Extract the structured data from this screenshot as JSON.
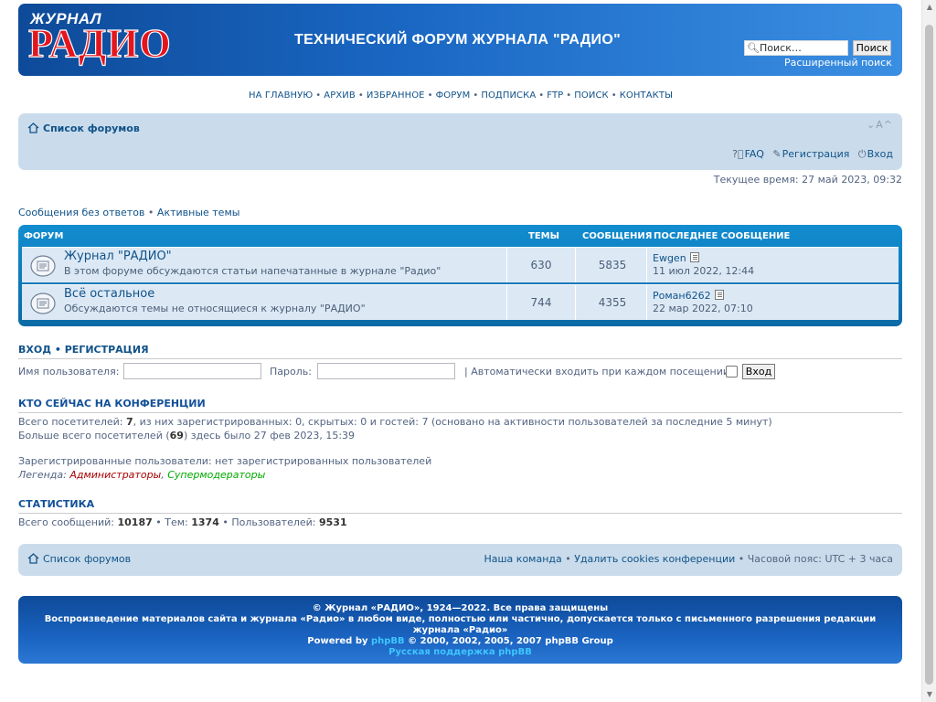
{
  "header": {
    "logo_top": "ЖУРНАЛ",
    "logo_main": "РАДИО",
    "site_title": "ТЕХНИЧЕСКИЙ ФОРУМ ЖУРНАЛА \"РАДИО\"",
    "search_placeholder": "Поиск…",
    "search_button": "Поиск",
    "advanced_search": "Расширенный поиск"
  },
  "nav_links": [
    "НА ГЛАВНУЮ",
    "АРХИВ",
    "ИЗБРАННОЕ",
    "ФОРУМ",
    "ПОДПИСКА",
    "FTP",
    "ПОИСК",
    "КОНТАКТЫ"
  ],
  "navbar": {
    "home": "Список форумов",
    "fontsize": "A A",
    "faq": "FAQ",
    "register": "Регистрация",
    "login": "Вход"
  },
  "current_time": "Текущее время: 27 май 2023, 09:32",
  "quick_links": {
    "unanswered": "Сообщения без ответов",
    "sep": "•",
    "active": "Активные темы"
  },
  "forum_table": {
    "headers": {
      "forum": "ФОРУМ",
      "topics": "ТЕМЫ",
      "posts": "СООБЩЕНИЯ",
      "last_post": "ПОСЛЕДНЕЕ СООБЩЕНИЕ"
    },
    "rows": [
      {
        "title": "Журнал \"РАДИО\"",
        "desc": "В этом форуме обсуждаются статьи напечатанные в журнале \"Радио\"",
        "topics": "630",
        "posts": "5835",
        "last_user": "Ewgen",
        "last_date": "11 июл 2022, 12:44"
      },
      {
        "title": "Всё остальное",
        "desc": "Обсуждаются темы не относящиеся к журналу \"РАДИО\"",
        "topics": "744",
        "posts": "4355",
        "last_user": "Роман6262",
        "last_date": "22 мар 2022, 07:10"
      }
    ]
  },
  "login": {
    "heading_login": "ВХОД",
    "heading_sep": "•",
    "heading_register": "РЕГИСТРАЦИЯ",
    "username_label": "Имя пользователя:",
    "password_label": "Пароль:",
    "autologin_label": "| Автоматически входить при каждом посещении",
    "submit": "Вход"
  },
  "online": {
    "heading": "КТО СЕЙЧАС НА КОНФЕРЕНЦИИ",
    "total_pre": "Всего посетителей: ",
    "total_num": "7",
    "total_post": ", из них зарегистрированных: 0, скрытых: 0 и гостей: 7 (основано на активности пользователей за последние 5 минут)",
    "max_pre": "Больше всего посетителей (",
    "max_num": "69",
    "max_post": ") здесь было 27 фев 2023, 15:39",
    "registered": "Зарегистрированные пользователи: нет зарегистрированных пользователей",
    "legend_label": "Легенда: ",
    "legend_admins": "Администраторы",
    "legend_sep": ", ",
    "legend_smods": "Супермодераторы"
  },
  "stats": {
    "heading": "СТАТИСТИКА",
    "posts_label": "Всего сообщений: ",
    "posts": "10187",
    "topics_label": " • Тем: ",
    "topics": "1374",
    "users_label": " • Пользователей: ",
    "users": "9531"
  },
  "footer_nav": {
    "home": "Список форумов",
    "team": "Наша команда",
    "sep": " • ",
    "delete_cookies": "Удалить cookies конференции",
    "timezone": "Часовой пояс: UTC + 3 часа"
  },
  "copyright": {
    "line1": "© Журнал «РАДИО», 1924—2022. Все права защищены",
    "line2": "Воспроизведение материалов сайта и журнала «Радио» в любом виде, полностью или частично, допускается только с письменного разрешения редакции журнала «Радио»",
    "powered_pre": "Powered by ",
    "powered_link": "phpBB",
    "powered_post": " © 2000, 2002, 2005, 2007 phpBB Group",
    "support": "Русская поддержка phpBB"
  },
  "colors": {
    "brand": "#1a68c4",
    "accent_red": "#e4151d",
    "nav_bg": "#cadceb",
    "table_head": "#128dd0"
  }
}
